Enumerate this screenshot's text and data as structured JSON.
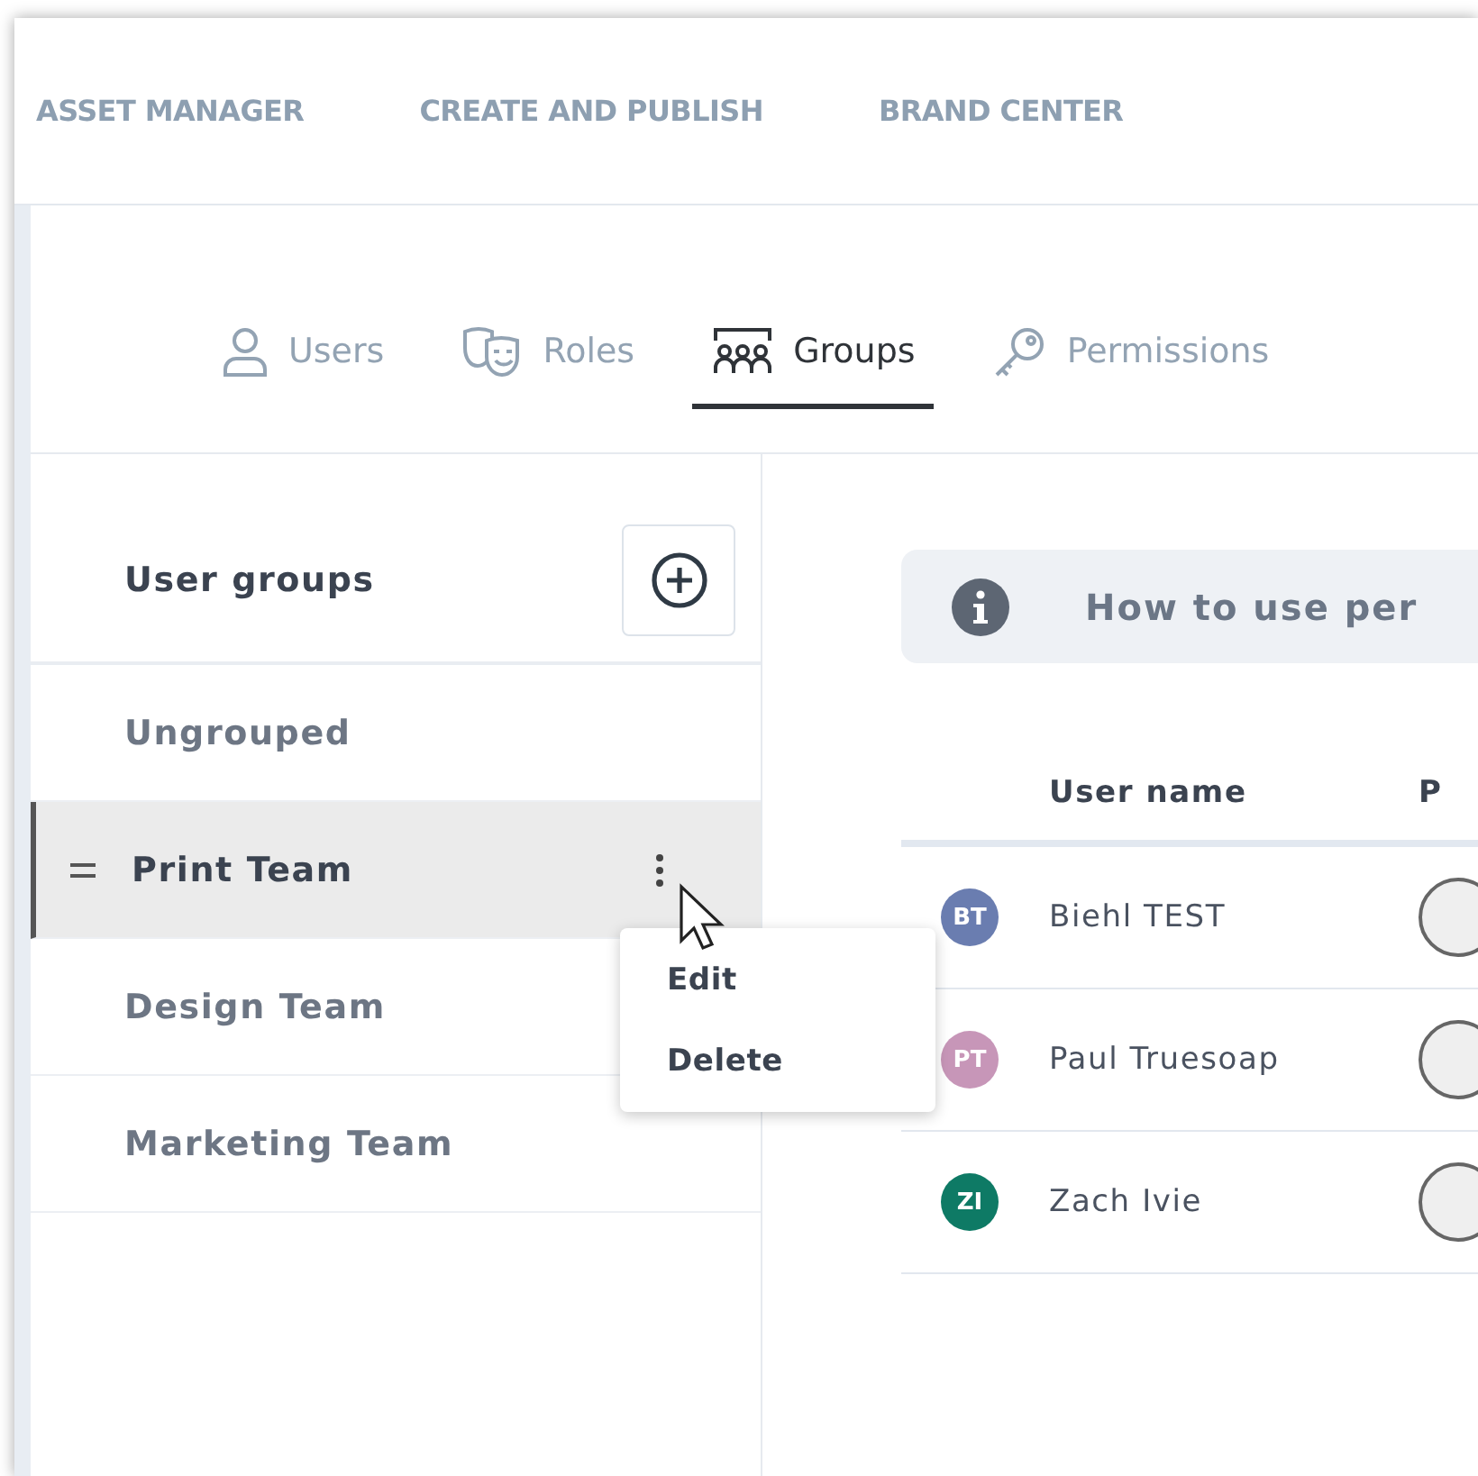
{
  "top_nav": {
    "items": [
      {
        "label": "ASSET MANAGER"
      },
      {
        "label": "CREATE AND PUBLISH"
      },
      {
        "label": "BRAND CENTER"
      }
    ]
  },
  "tabs": [
    {
      "label": "Users",
      "selected": false
    },
    {
      "label": "Roles",
      "selected": false
    },
    {
      "label": "Groups",
      "selected": true
    },
    {
      "label": "Permissions",
      "selected": false
    }
  ],
  "sidebar": {
    "title": "User groups",
    "items": [
      {
        "label": "Ungrouped",
        "selected": false
      },
      {
        "label": "Print Team",
        "selected": true
      },
      {
        "label": "Design Team",
        "selected": false
      },
      {
        "label": "Marketing Team",
        "selected": false
      }
    ]
  },
  "context_menu": {
    "items": [
      "Edit",
      "Delete"
    ]
  },
  "info_banner": {
    "text": "How to use per"
  },
  "table": {
    "columns": [
      "User name",
      "P"
    ],
    "rows": [
      {
        "initials": "BT",
        "color": "#6a7db0",
        "name": "Biehl TEST"
      },
      {
        "initials": "PT",
        "color": "#c796b8",
        "name": "Paul Truesoap"
      },
      {
        "initials": "ZI",
        "color": "#0e7a65",
        "name": "Zach Ivie"
      }
    ]
  }
}
